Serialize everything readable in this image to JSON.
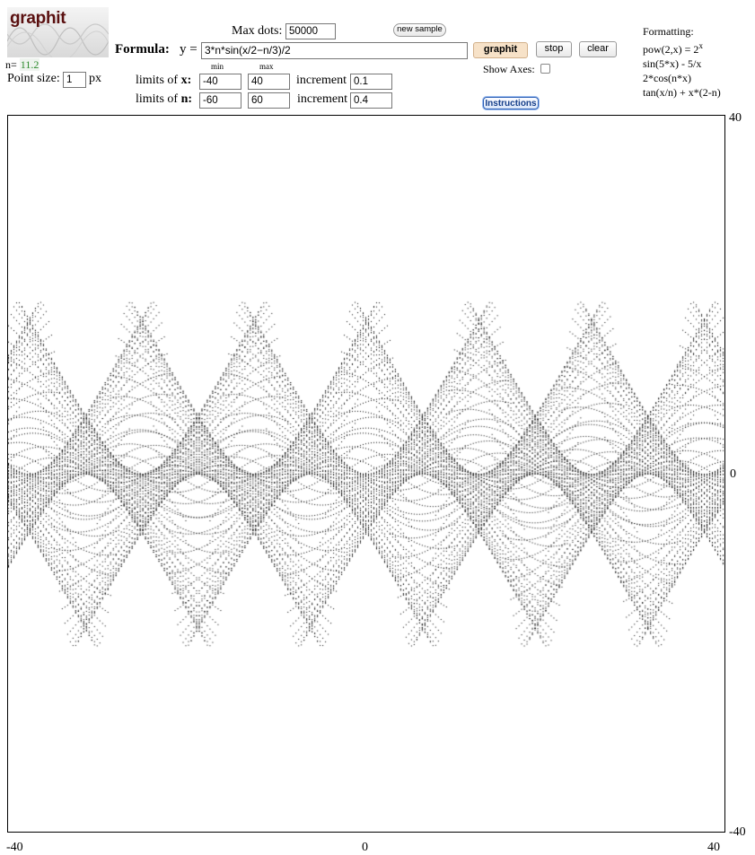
{
  "app": {
    "logo_text": "graphit"
  },
  "status": {
    "n_label": "n=",
    "n_value": "11.2",
    "n_value_color": "#2c8a2c"
  },
  "point_size": {
    "label": "Point size:",
    "value": "1",
    "unit": "px"
  },
  "max_dots": {
    "label": "Max dots:",
    "value": "50000"
  },
  "buttons": {
    "new_sample": "new sample",
    "graphit": "graphit",
    "stop": "stop",
    "clear": "clear",
    "instructions": "Instructions"
  },
  "formula": {
    "label": "Formula:",
    "y_label": "y =",
    "value": "3*n*sin(x/2−n/3)/2"
  },
  "show_axes": {
    "label": "Show Axes:",
    "checked": false
  },
  "limits_x": {
    "label_prefix": "limits of",
    "var": "x",
    "min_header": "min",
    "max_header": "max",
    "min": "-40",
    "max": "40",
    "increment_label": "increment",
    "increment": "0.1"
  },
  "limits_n": {
    "label_prefix": "limits of",
    "var": "n",
    "min": "-60",
    "max": "60",
    "increment_label": "increment",
    "increment": "0.4"
  },
  "formatting": {
    "title": "Formatting:",
    "ex1_base": "pow(2,x) = 2",
    "ex1_sup": "x",
    "ex2": "sin(5*x) - 5/x",
    "ex3": "2*cos(n*x)",
    "ex4": "tan(x/n) + x*(2-n)"
  },
  "axis": {
    "y_max": "40",
    "y_zero": "0",
    "y_min": "-40",
    "x_min": "-40",
    "x_zero": "0",
    "x_max": "40"
  },
  "chart_data": {
    "type": "scatter",
    "xlim": [
      -40,
      40
    ],
    "ylim": [
      -40,
      40
    ],
    "n_range": [
      -16,
      16
    ],
    "n_step": 0.4,
    "x_step": 0.1,
    "formula": "3*n*sin(x/2−n/3)/2",
    "point_color": "#000000"
  }
}
